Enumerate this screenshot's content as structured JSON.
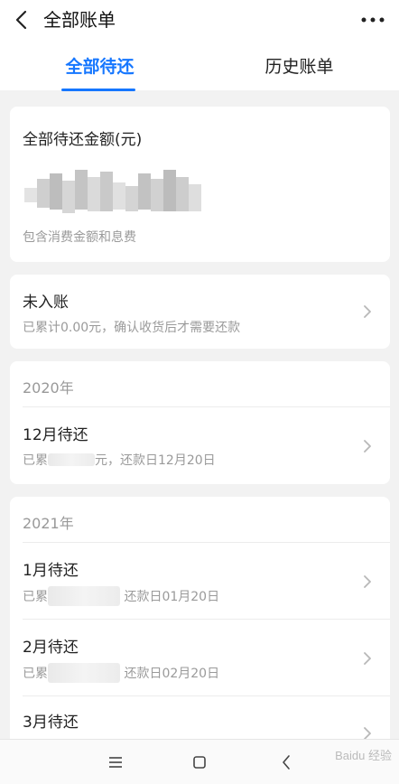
{
  "nav": {
    "title": "全部账单",
    "more": "···"
  },
  "tabs": [
    {
      "label": "全部待还",
      "active": true
    },
    {
      "label": "历史账单",
      "active": false
    }
  ],
  "summary": {
    "label": "全部待还金额(元)",
    "note": "包含消费金额和息费"
  },
  "unposted": {
    "title": "未入账",
    "detail": "已累计0.00元，确认收货后才需要还款"
  },
  "groups": [
    {
      "year": "2020年",
      "items": [
        {
          "title": "12月待还",
          "prefix": "已累",
          "suffix": "元，还款日12月20日"
        }
      ]
    },
    {
      "year": "2021年",
      "items": [
        {
          "title": "1月待还",
          "prefix": "已累",
          "suffix": "还款日01月20日"
        },
        {
          "title": "2月待还",
          "prefix": "已累",
          "suffix": "还款日02月20日"
        },
        {
          "title": "3月待还"
        }
      ]
    }
  ],
  "colors": {
    "accent": "#1677ff",
    "background": "#f2f2f2"
  },
  "system_nav": {
    "menu_icon": "menu-icon",
    "home_icon": "home-icon",
    "back_icon": "back-icon"
  },
  "watermark": "Baidu 经验"
}
